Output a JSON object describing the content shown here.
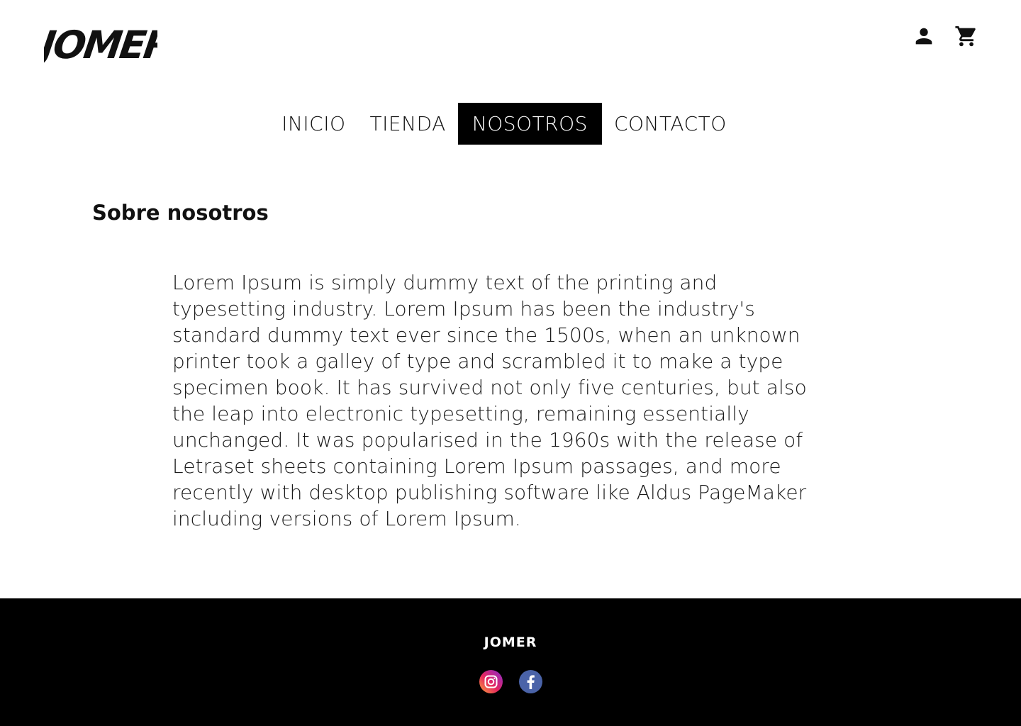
{
  "header": {
    "brand_logo_text": "JOMER",
    "icons": [
      "user-icon",
      "shopping-cart-icon"
    ]
  },
  "nav": {
    "items": [
      {
        "label": "INICIO",
        "active": false
      },
      {
        "label": "TIENDA",
        "active": false
      },
      {
        "label": "NOSOTROS",
        "active": true
      },
      {
        "label": "CONTACTO",
        "active": false
      }
    ],
    "active_bg": "#000000",
    "active_fg": "#ffffff"
  },
  "about": {
    "title": "Sobre nosotros",
    "body": " Lorem Ipsum is simply dummy text of the printing and\ntypesetting industry. Lorem Ipsum has been the industry's\nstandard dummy text ever since the 1500s, when an unknown\nprinter took a galley of type and scrambled it to make a type\nspecimen book. It has survived not only five centuries, but also\nthe leap into electronic typesetting, remaining essentially\nunchanged. It was popularised in the 1960s with the release of\nLetraset sheets containing Lorem Ipsum passages, and more\nrecently with desktop publishing software like Aldus PageMaker\nincluding versions of Lorem Ipsum."
  },
  "footer": {
    "brand": "JOMER",
    "social": [
      "instagram-icon",
      "facebook-icon"
    ],
    "background": "#000000"
  }
}
